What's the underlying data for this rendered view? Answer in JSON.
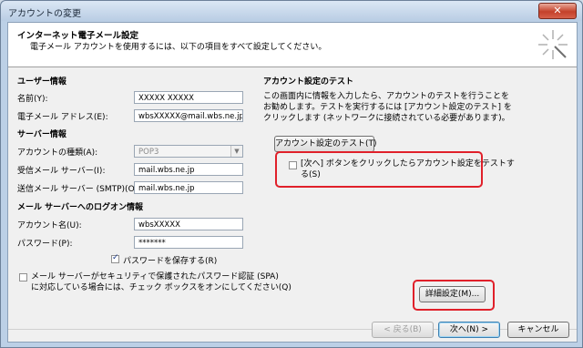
{
  "window": {
    "title": "アカウントの変更",
    "close_glyph": "✕"
  },
  "header": {
    "title": "インターネット電子メール設定",
    "subtitle": "電子メール アカウントを使用するには、以下の項目をすべて設定してください。"
  },
  "user_info": {
    "heading": "ユーザー情報",
    "name_label": "名前(Y):",
    "name_value": "XXXXX XXXXX",
    "email_label": "電子メール アドレス(E):",
    "email_value": "wbsXXXXX@mail.wbs.ne.jp"
  },
  "server_info": {
    "heading": "サーバー情報",
    "account_type_label": "アカウントの種類(A):",
    "account_type_value": "POP3",
    "incoming_label": "受信メール サーバー(I):",
    "incoming_value": "mail.wbs.ne.jp",
    "outgoing_label": "送信メール サーバー (SMTP)(O):",
    "outgoing_value": "mail.wbs.ne.jp"
  },
  "logon_info": {
    "heading": "メール サーバーへのログオン情報",
    "account_name_label": "アカウント名(U):",
    "account_name_value": "wbsXXXXX",
    "password_label": "パスワード(P):",
    "password_value": "*******",
    "save_password_label": "パスワードを保存する(R)",
    "spa_line1": "メール サーバーがセキュリティで保護されたパスワード認証 (SPA)",
    "spa_line2": "に対応している場合には、チェック ボックスをオンにしてください(Q)"
  },
  "test": {
    "heading": "アカウント設定のテスト",
    "desc_line1": "この画面内に情報を入力したら、アカウントのテストを行うことを",
    "desc_line2": "お勧めします。テストを実行するには [アカウント設定のテスト] を",
    "desc_line3": "クリックします (ネットワークに接続されている必要があります)。",
    "test_button": "アカウント設定のテスト(T)",
    "next_test_line1": "[次へ] ボタンをクリックしたらアカウント設定をテストす",
    "next_test_line2": "る(S)"
  },
  "buttons": {
    "advanced": "詳細設定(M)...",
    "back": "< 戻る(B)",
    "next": "次へ(N) >",
    "cancel": "キャンセル"
  },
  "colors": {
    "highlight": "#e0202a"
  }
}
